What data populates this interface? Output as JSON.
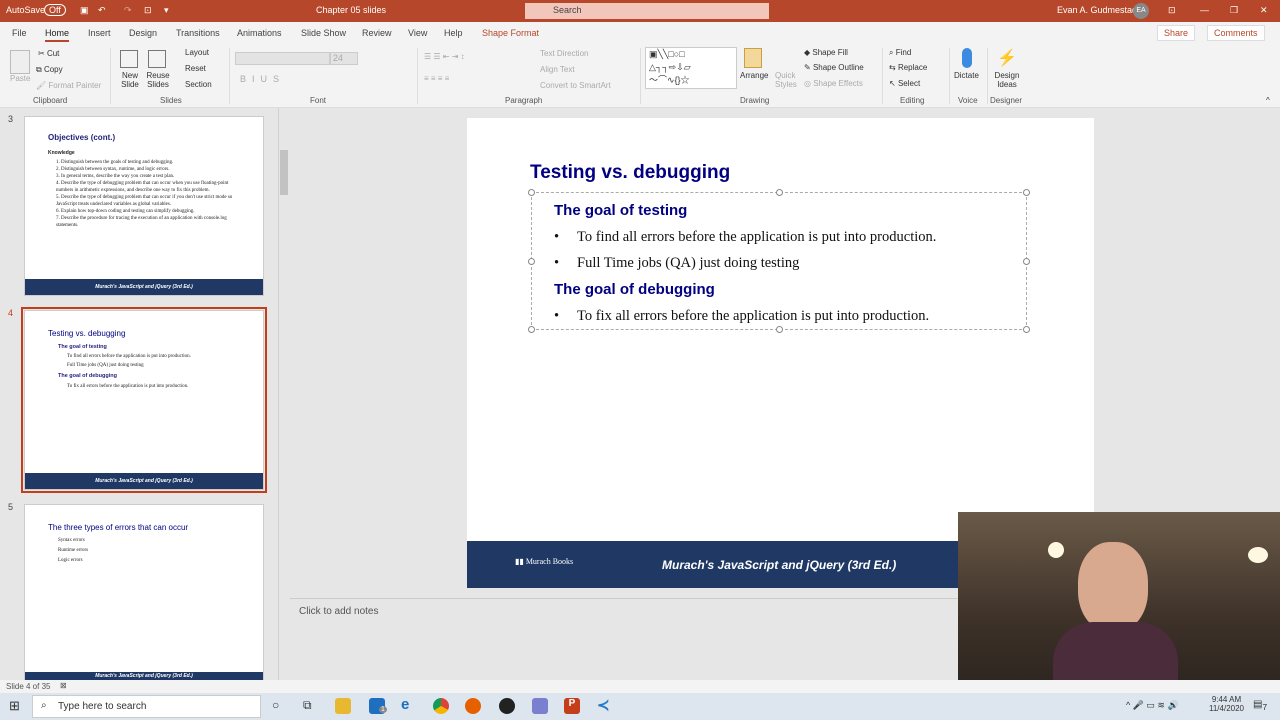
{
  "titlebar": {
    "autosave": "AutoSave",
    "autosave_state": "Off",
    "doc_title": "Chapter 05 slides",
    "search": "Search",
    "user": "Evan A. Gudmestad",
    "user_initials": "EA"
  },
  "tabs": [
    "File",
    "Home",
    "Insert",
    "Design",
    "Transitions",
    "Animations",
    "Slide Show",
    "Review",
    "View",
    "Help",
    "Shape Format"
  ],
  "share": "Share",
  "comments": "Comments",
  "ribbon": {
    "clipboard": {
      "label": "Clipboard",
      "paste": "Paste",
      "cut": "Cut",
      "copy": "Copy",
      "format_painter": "Format Painter"
    },
    "slides": {
      "label": "Slides",
      "new_slide": "New Slide",
      "reuse_slides": "Reuse Slides",
      "layout": "Layout",
      "reset": "Reset",
      "section": "Section"
    },
    "font": {
      "label": "Font",
      "size": "24"
    },
    "paragraph": {
      "label": "Paragraph",
      "text_direction": "Text Direction",
      "align_text": "Align Text",
      "convert": "Convert to SmartArt"
    },
    "drawing": {
      "label": "Drawing",
      "arrange": "Arrange",
      "quick_styles": "Quick Styles",
      "shape_fill": "Shape Fill",
      "shape_outline": "Shape Outline",
      "shape_effects": "Shape Effects"
    },
    "editing": {
      "label": "Editing",
      "find": "Find",
      "replace": "Replace",
      "select": "Select"
    },
    "voice": {
      "label": "Voice",
      "dictate": "Dictate"
    },
    "designer": {
      "label": "Designer",
      "design_ideas": "Design Ideas"
    }
  },
  "thumbnails": [
    {
      "num": "3",
      "title": "Objectives (cont.)",
      "subtitle": "Knowledge",
      "items": [
        "1. Distinguish between the goals of testing and debugging.",
        "2. Distinguish between syntax, runtime, and logic errors.",
        "3. In general terms, describe the way you create a test plan.",
        "4. Describe the type of debugging problem that can occur when you use floating-point numbers in arithmetic expressions, and describe one way to fix this problem.",
        "5. Describe the type of debugging problem that can occur if you don't use strict mode so JavaScript treats undeclared variables as global variables.",
        "6. Explain how top-down coding and testing can simplify debugging.",
        "7. Describe the procedure for tracing the execution of an application with console.log statements."
      ]
    },
    {
      "num": "4",
      "title": "Testing vs. debugging",
      "h1": "The goal of testing",
      "b1": "To find all errors before the application is put into production.",
      "b2": "Full Time jobs (QA) just doing testing",
      "h2": "The goal of debugging",
      "b3": "To fix all errors before the application is put into production."
    },
    {
      "num": "5",
      "title": "The three types of errors that can occur",
      "items": [
        "Syntax errors",
        "Runtime errors",
        "Logic errors"
      ]
    }
  ],
  "footer_text": "Murach's JavaScript and jQuery (3rd Ed.)",
  "footer_logo": "Murach Books",
  "slide": {
    "title": "Testing vs. debugging",
    "heading1": "The goal of testing",
    "bullet1": "To find all errors before the application is put into production.",
    "bullet2": "Full Time jobs (QA) just doing testing",
    "heading2": "The goal of debugging",
    "bullet3": "To fix all errors before the application is put into production."
  },
  "notes_placeholder": "Click to add notes",
  "status": {
    "slide_count": "Slide 4 of 35"
  },
  "taskbar": {
    "search": "Type here to search",
    "time": "9:44 AM",
    "date": "11/4/2020",
    "notifications": "7",
    "mail_badge": "1"
  }
}
